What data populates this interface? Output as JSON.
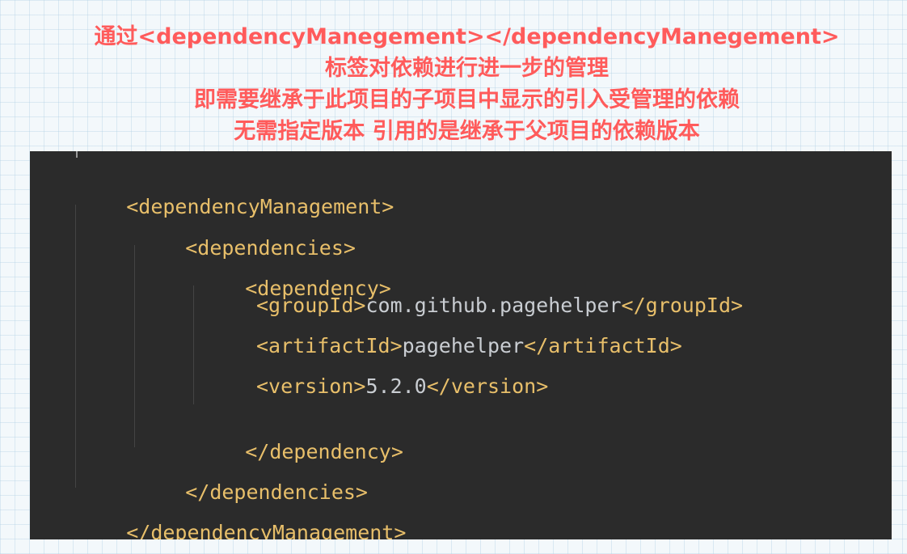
{
  "annotation": {
    "line1": "通过<dependencyManegement></dependencyManegement>",
    "line2": "标签对依赖进行进一步的管理",
    "line3": "即需要继承于此项目的子项目中显示的引入受管理的依赖",
    "line4": "无需指定版本 引用的是继承于父项目的依赖版本"
  },
  "code": {
    "management_open": "<dependencyManagement>",
    "dependencies_open": "<dependencies>",
    "dependency_open": "<dependency>",
    "groupId": {
      "open": "<groupId>",
      "value": "com.github.pagehelper",
      "close": "</groupId>"
    },
    "artifactId": {
      "open": "<artifactId>",
      "value": "pagehelper",
      "close": "</artifactId>"
    },
    "version": {
      "open": "<version>",
      "value": "5.2.0",
      "close": "</version>"
    },
    "dependency_close": "</dependency>",
    "dependencies_close": "</dependencies>",
    "management_close": "</dependencyManagement>"
  },
  "colors": {
    "annotation_text": "#ff5b5b",
    "editor_background": "#2b2b2b",
    "xml_tag": "#e8bf6a",
    "xml_text": "#c9cdd2"
  }
}
